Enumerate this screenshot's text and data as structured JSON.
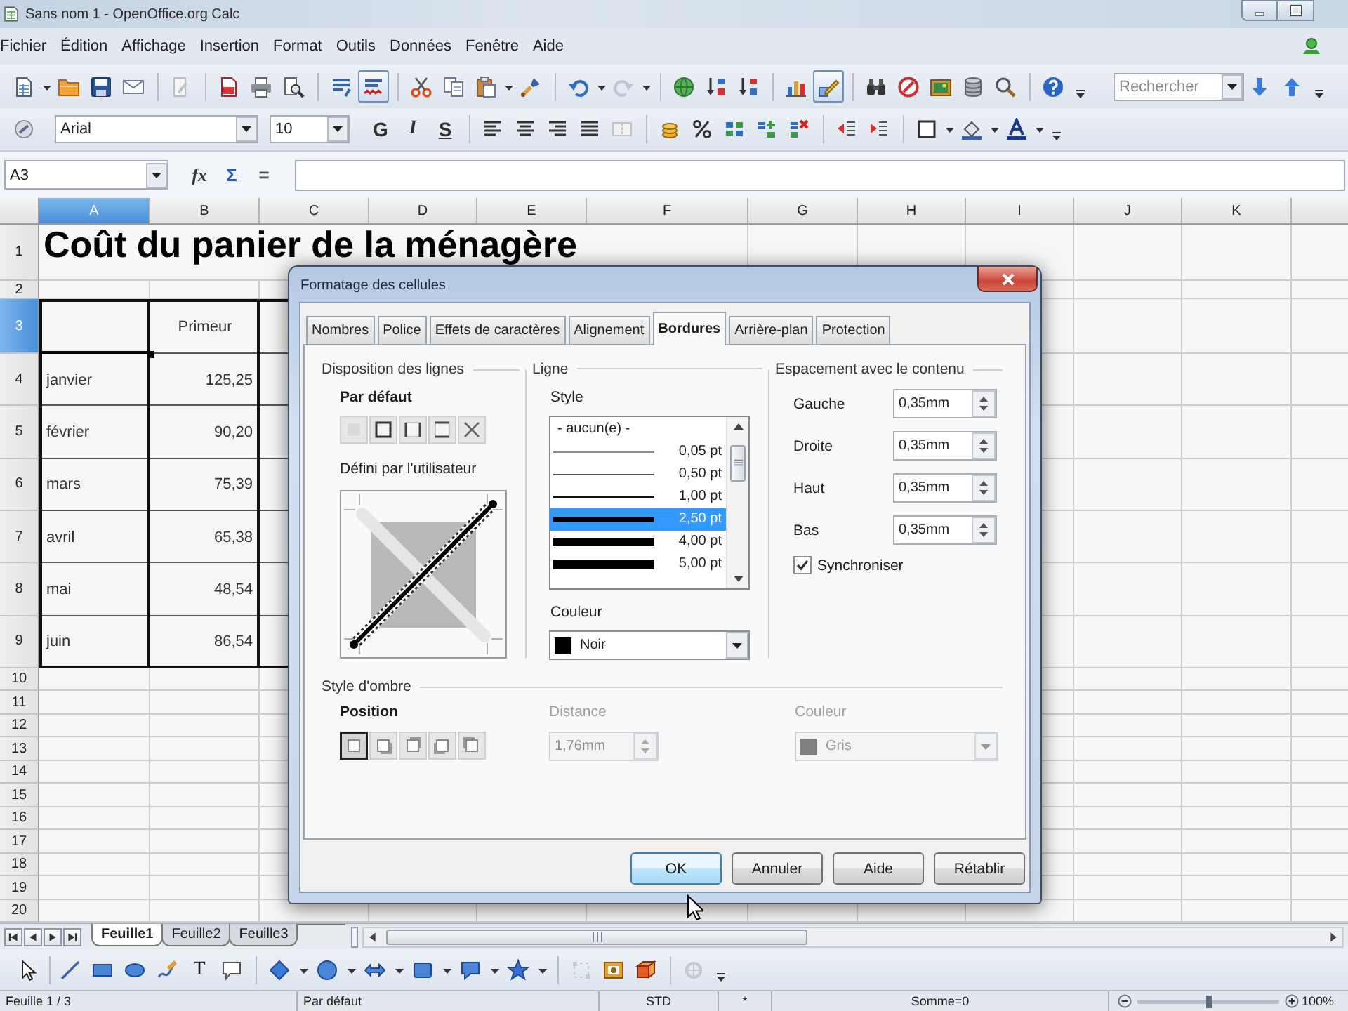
{
  "window": {
    "title": "Sans nom 1 - OpenOffice.org Calc"
  },
  "menu": [
    "Fichier",
    "Édition",
    "Affichage",
    "Insertion",
    "Format",
    "Outils",
    "Données",
    "Fenêtre",
    "Aide"
  ],
  "standard_toolbar": {
    "toggle_buttons": [
      {
        "on": true
      },
      {
        "on": true
      }
    ],
    "search": {
      "placeholder": "Rechercher"
    }
  },
  "formatting_toolbar": {
    "font_name": "Arial",
    "font_size": "10",
    "style_buttons": [
      "G",
      "I",
      "S"
    ]
  },
  "formula_bar": {
    "cell_reference": "A3",
    "buttons": [
      "fx",
      "Σ",
      "="
    ]
  },
  "sheet": {
    "columns": [
      {
        "label": "A",
        "selected": true
      },
      {
        "label": "B",
        "selected": false
      },
      {
        "label": "C",
        "selected": false
      },
      {
        "label": "D",
        "selected": false
      },
      {
        "label": "E",
        "selected": false
      },
      {
        "label": "F",
        "selected": false
      },
      {
        "label": "G",
        "selected": false
      },
      {
        "label": "H",
        "selected": false
      },
      {
        "label": "I",
        "selected": false
      },
      {
        "label": "J",
        "selected": false
      },
      {
        "label": "K",
        "selected": false
      }
    ],
    "rows": [
      {
        "label": "1",
        "kind": "title",
        "selected": false,
        "column_a": "Coût du panier de la ménagère"
      },
      {
        "label": "2",
        "kind": "spacer",
        "selected": false
      },
      {
        "label": "3",
        "kind": "header",
        "selected": true,
        "column_b": "Primeur"
      },
      {
        "label": "4",
        "kind": "data",
        "selected": false,
        "column_a": "janvier",
        "column_b": "125,25"
      },
      {
        "label": "5",
        "kind": "data",
        "selected": false,
        "column_a": "février",
        "column_b": "90,20"
      },
      {
        "label": "6",
        "kind": "data",
        "selected": false,
        "column_a": "mars",
        "column_b": "75,39"
      },
      {
        "label": "7",
        "kind": "data",
        "selected": false,
        "column_a": "avril",
        "column_b": "65,38"
      },
      {
        "label": "8",
        "kind": "data",
        "selected": false,
        "column_a": "mai",
        "column_b": "48,54"
      },
      {
        "label": "9",
        "kind": "data",
        "selected": false,
        "column_a": "juin",
        "column_b": "86,54"
      },
      {
        "label": "10",
        "kind": "plain",
        "selected": false
      },
      {
        "label": "11",
        "kind": "plain",
        "selected": false
      },
      {
        "label": "12",
        "kind": "plain",
        "selected": false
      },
      {
        "label": "13",
        "kind": "plain",
        "selected": false
      },
      {
        "label": "14",
        "kind": "plain",
        "selected": false
      },
      {
        "label": "15",
        "kind": "plain",
        "selected": false
      },
      {
        "label": "16",
        "kind": "plain",
        "selected": false
      },
      {
        "label": "17",
        "kind": "plain",
        "selected": false
      },
      {
        "label": "18",
        "kind": "plain",
        "selected": false
      },
      {
        "label": "19",
        "kind": "plain",
        "selected": false
      },
      {
        "label": "20",
        "kind": "plain",
        "selected": false
      }
    ]
  },
  "sheet_tabs": [
    {
      "label": "Feuille1",
      "selected": true
    },
    {
      "label": "Feuille2",
      "selected": false
    },
    {
      "label": "Feuille3",
      "selected": false
    }
  ],
  "drawing_toolbar": {
    "text_tool": "T"
  },
  "status_bar": {
    "sheet": "Feuille 1 / 3",
    "page_style": "Par défaut",
    "selection_mode": "STD",
    "modified": "*",
    "sum": "Somme=0",
    "zoom_slider": {
      "level": 0.5
    },
    "zoom": "100%"
  },
  "dialog": {
    "title": "Formatage des cellules",
    "tabs": [
      {
        "label": "Nombres",
        "selected": false
      },
      {
        "label": "Police",
        "selected": false
      },
      {
        "label": "Effets de caractères",
        "selected": false
      },
      {
        "label": "Alignement",
        "selected": false
      },
      {
        "label": "Bordures",
        "selected": true
      },
      {
        "label": "Arrière-plan",
        "selected": false
      },
      {
        "label": "Protection",
        "selected": false
      }
    ],
    "line_arrangement": {
      "title": "Disposition des lignes",
      "default_label": "Par défaut",
      "user_defined_label": "Défini par l'utilisateur"
    },
    "line": {
      "title": "Ligne",
      "style_label": "Style",
      "styles": [
        {
          "label": "- aucun(e) -",
          "selected": false
        },
        {
          "label": "0,05 pt",
          "selected": false
        },
        {
          "label": "0,50 pt",
          "selected": false
        },
        {
          "label": "1,00 pt",
          "selected": false
        },
        {
          "label": "2,50 pt",
          "selected": true
        },
        {
          "label": "4,00 pt",
          "selected": false
        },
        {
          "label": "5,00 pt",
          "selected": false
        }
      ],
      "color_label": "Couleur",
      "color": {
        "value": "Noir",
        "color": "#000000"
      }
    },
    "spacing": {
      "title": "Espacement avec le contenu",
      "fields": [
        {
          "label": "Gauche",
          "value": "0,35mm"
        },
        {
          "label": "Droite",
          "value": "0,35mm"
        },
        {
          "label": "Haut",
          "value": "0,35mm"
        },
        {
          "label": "Bas",
          "value": "0,35mm"
        }
      ],
      "synchronize": {
        "label": "Synchroniser",
        "checked": true
      }
    },
    "shadow": {
      "title": "Style d'ombre",
      "position_label": "Position",
      "positions": [
        {
          "selected": true
        },
        {
          "selected": false
        },
        {
          "selected": false
        },
        {
          "selected": false
        },
        {
          "selected": false
        }
      ],
      "distance": {
        "label": "Distance",
        "value": "1,76mm",
        "disabled": true
      },
      "color": {
        "label": "Couleur",
        "value": "Gris",
        "color": "#808080",
        "disabled": true
      }
    },
    "buttons": [
      {
        "label": "OK",
        "default": true
      },
      {
        "label": "Annuler",
        "default": false
      },
      {
        "label": "Aide",
        "default": false
      },
      {
        "label": "Rétablir",
        "default": false
      }
    ]
  }
}
